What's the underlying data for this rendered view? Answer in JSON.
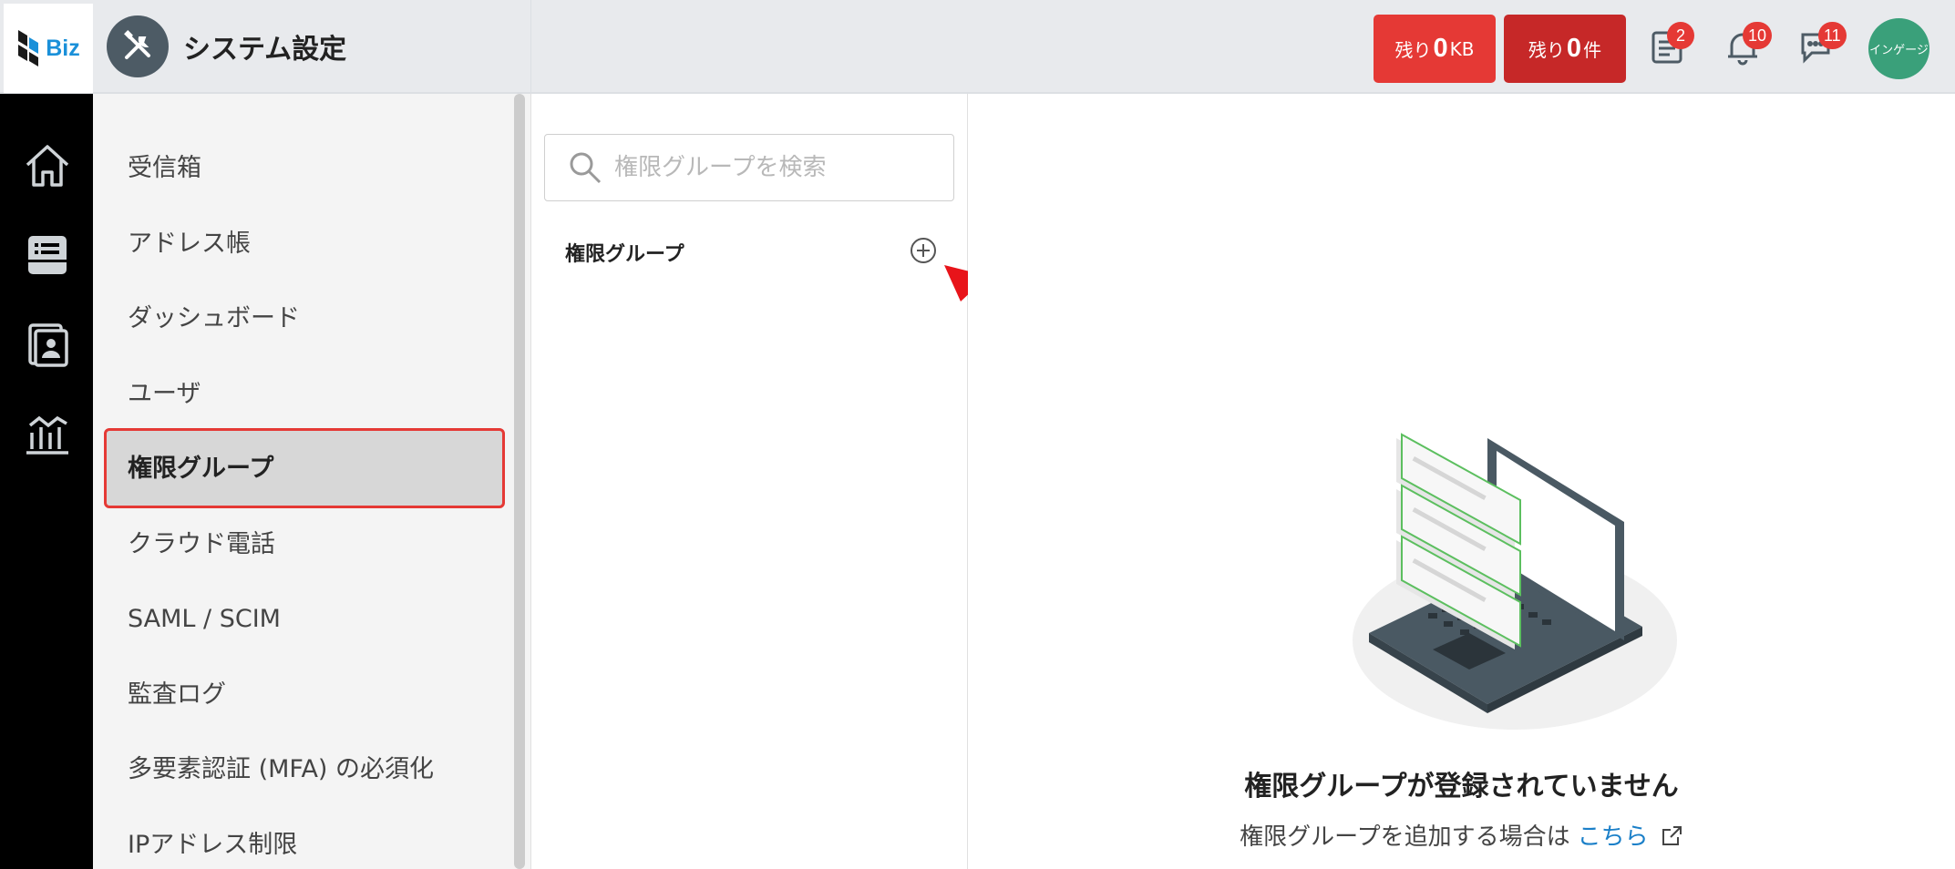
{
  "app": {
    "logo_text": "Biz",
    "page_title": "システム設定"
  },
  "header": {
    "quota_storage": {
      "prefix": "残り",
      "value": "0",
      "unit": "KB"
    },
    "quota_count": {
      "prefix": "残り",
      "value": "0",
      "unit": "件"
    },
    "badges": {
      "tasks": "2",
      "notifications": "10",
      "chat": "11"
    },
    "avatar_text": "インゲージ"
  },
  "rail": {
    "icons": [
      "home-icon",
      "inbox-icon",
      "contacts-icon",
      "dashboard-icon"
    ]
  },
  "menu": {
    "items": [
      {
        "label": "受信箱"
      },
      {
        "label": "アドレス帳"
      },
      {
        "label": "ダッシュボード"
      },
      {
        "label": "ユーザ"
      },
      {
        "label": "権限グループ"
      },
      {
        "label": "クラウド電話"
      },
      {
        "label": "SAML / SCIM"
      },
      {
        "label": "監査ログ"
      },
      {
        "label": "多要素認証 (MFA) の必須化"
      },
      {
        "label": "IPアドレス制限"
      }
    ],
    "active_index": 4
  },
  "list_panel": {
    "search_placeholder": "権限グループを検索",
    "heading": "権限グループ"
  },
  "empty_state": {
    "title": "権限グループが登録されていません",
    "description": "権限グループを追加する場合は",
    "link_text": "こちら"
  },
  "colors": {
    "accent_red": "#e53935",
    "dark_red": "#c62828",
    "avatar_green": "#3aa07a",
    "link_blue": "#1a7fc8",
    "illustration_green": "#5cbf5f"
  }
}
